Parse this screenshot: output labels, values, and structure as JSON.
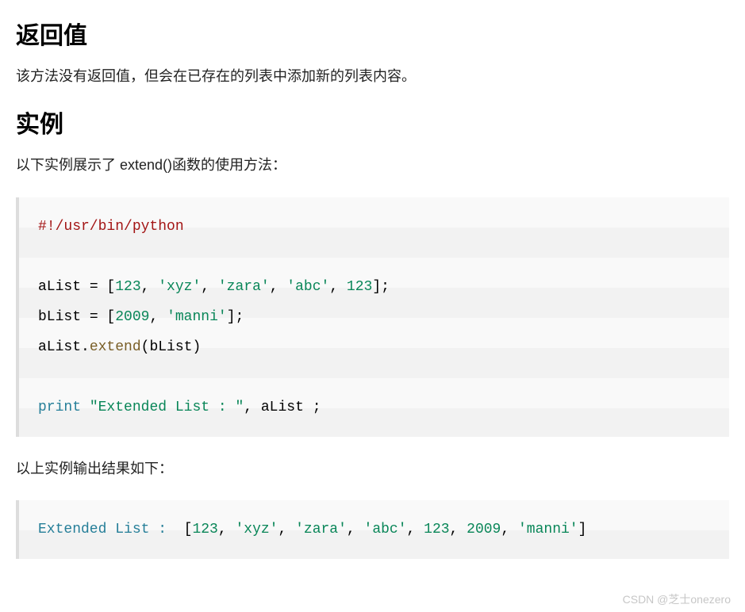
{
  "sections": {
    "h1": "返回值",
    "p1": "该方法没有返回值，但会在已存在的列表中添加新的列表内容。",
    "h2": "实例",
    "p2": "以下实例展示了 extend()函数的使用方法：",
    "p3": "以上实例输出结果如下："
  },
  "code1": {
    "shebang": "#!/usr/bin/python",
    "aList_name": "aList",
    "eq": " = ",
    "lb": "[",
    "rb": "]",
    "n123": "123",
    "s_xyz": "'xyz'",
    "s_zara": "'zara'",
    "s_abc": "'abc'",
    "semi": ";",
    "comma": ", ",
    "bList_name": "bList",
    "n2009": "2009",
    "s_manni": "'manni'",
    "dot": ".",
    "extend": "extend",
    "lp": "(",
    "rp": ")",
    "print": "print",
    "s_ext": "\"Extended List : \""
  },
  "code2": {
    "label": "Extended List :  ",
    "lb": "[",
    "n123a": "123",
    "s_xyz": "'xyz'",
    "s_zara": "'zara'",
    "s_abc": "'abc'",
    "n123b": "123",
    "n2009": "2009",
    "s_manni": "'manni'",
    "rb": "]",
    "comma": ", "
  },
  "watermark": "CSDN @芝士onezero"
}
